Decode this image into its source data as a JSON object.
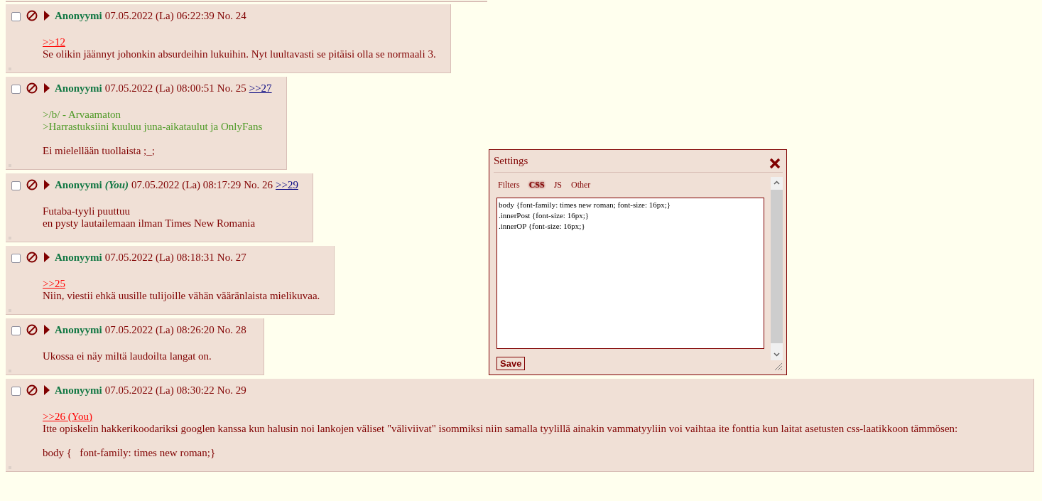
{
  "posts": [
    {
      "checked": false,
      "name": "Anonyymi",
      "you": false,
      "date": "07.05.2022 (La) 06:22:39",
      "number": "No. 24",
      "paragraphs": [
        [
          {
            "kind": "reply_link",
            "text": ">>12"
          },
          {
            "kind": "text",
            "text": "Se olikin jäännyt johonkin absurdeihin lukuihin. Nyt luultavasti se pitäisi olla se normaali 3."
          }
        ]
      ]
    },
    {
      "checked": false,
      "name": "Anonyymi",
      "you": false,
      "date": "07.05.2022 (La) 08:00:51",
      "number": "No. 25",
      "backlinks": [
        ">>27"
      ],
      "paragraphs": [
        [
          {
            "kind": "greentext",
            "text": ">/b/ - Arvaamaton"
          },
          {
            "kind": "greentext",
            "text": ">Harrastuksiini kuuluu juna-aikataulut ja OnlyFans"
          }
        ],
        [
          {
            "kind": "text",
            "text": "Ei mielellään tuollaista ;_;"
          }
        ]
      ]
    },
    {
      "checked": false,
      "name": "Anonyymi",
      "you": true,
      "you_label": "(You)",
      "date": "07.05.2022 (La) 08:17:29",
      "number": "No. 26",
      "backlinks": [
        ">>29"
      ],
      "paragraphs": [
        [
          {
            "kind": "text",
            "text": "Futaba-tyyli puuttuu"
          },
          {
            "kind": "text",
            "text": "en pysty lautailemaan ilman Times New Romania"
          }
        ]
      ]
    },
    {
      "checked": false,
      "name": "Anonyymi",
      "you": false,
      "date": "07.05.2022 (La) 08:18:31",
      "number": "No. 27",
      "paragraphs": [
        [
          {
            "kind": "reply_link",
            "text": ">>25"
          },
          {
            "kind": "text",
            "text": "Niin, viestii ehkä uusille tulijoille vähän vääränlaista mielikuvaa."
          }
        ]
      ]
    },
    {
      "checked": false,
      "name": "Anonyymi",
      "you": false,
      "date": "07.05.2022 (La) 08:26:20",
      "number": "No. 28",
      "paragraphs": [
        [
          {
            "kind": "text",
            "text": "Ukossa ei näy miltä laudoilta langat on."
          }
        ]
      ]
    },
    {
      "checked": false,
      "name": "Anonyymi",
      "you": false,
      "date": "07.05.2022 (La) 08:30:22",
      "number": "No. 29",
      "paragraphs": [
        [
          {
            "kind": "reply_link",
            "text": ">>26 (You)"
          },
          {
            "kind": "text",
            "text": "Itte opiskelin hakkerikoodariksi googlen kanssa kun halusin noi lankojen väliset \"väliviivat\" isommiksi niin samalla tyylillä ainakin vammatyyliin voi vaihtaa ite fonttia kun laitat asetusten css-laatikkoon tämmösen:"
          }
        ],
        [
          {
            "kind": "text",
            "text": "body {   font-family: times new roman;}"
          }
        ]
      ]
    }
  ],
  "settings": {
    "title": "Settings",
    "tabs": [
      {
        "label": "Filters",
        "selected": false
      },
      {
        "label": "CSS",
        "selected": true
      },
      {
        "label": "JS",
        "selected": false
      },
      {
        "label": "Other",
        "selected": false
      }
    ],
    "css_value": "body {font-family: times new roman; font-size: 16px;}\n.innerPost {font-size: 16px;}\n.innerOP {font-size: 16px;}",
    "save_button": "Save"
  }
}
